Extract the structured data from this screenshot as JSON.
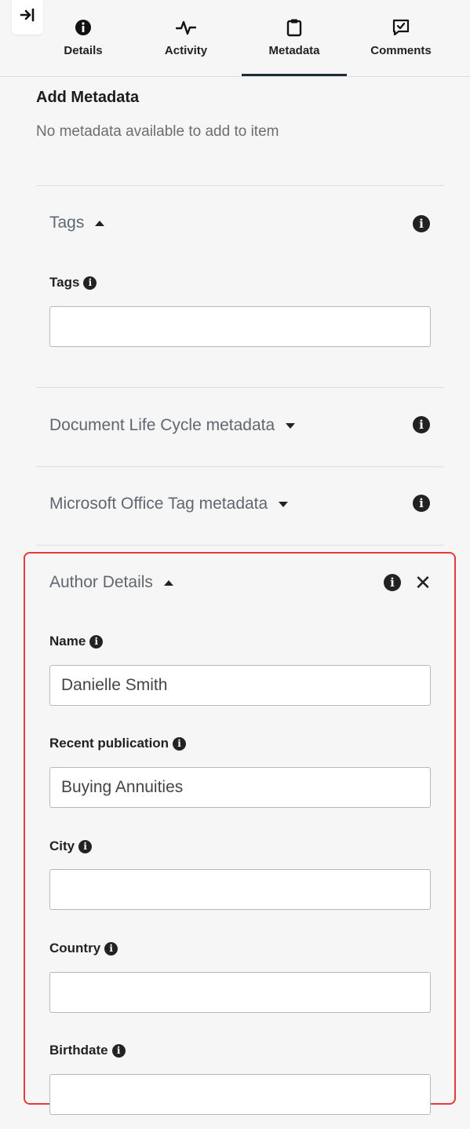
{
  "tabs": [
    {
      "label": "Details",
      "icon": "info-icon"
    },
    {
      "label": "Activity",
      "icon": "activity-icon"
    },
    {
      "label": "Metadata",
      "icon": "clipboard-icon",
      "active": true
    },
    {
      "label": "Comments",
      "icon": "comment-check-icon"
    }
  ],
  "add_metadata": {
    "title": "Add Metadata",
    "empty_text": "No metadata available to add to item"
  },
  "sections": {
    "tags": {
      "title": "Tags",
      "expanded": true,
      "fields": [
        {
          "label": "Tags",
          "value": ""
        }
      ]
    },
    "doc_life_cycle": {
      "title": "Document Life Cycle metadata",
      "expanded": false
    },
    "ms_office": {
      "title": "Microsoft Office Tag metadata",
      "expanded": false
    },
    "author": {
      "title": "Author Details",
      "expanded": true,
      "fields": [
        {
          "label": "Name",
          "value": "Danielle Smith"
        },
        {
          "label": "Recent publication",
          "value": "Buying Annuities"
        },
        {
          "label": "City",
          "value": ""
        },
        {
          "label": "Country",
          "value": ""
        },
        {
          "label": "Birthdate",
          "value": ""
        }
      ]
    }
  },
  "colors": {
    "highlight": "#e23b3b",
    "active_tab": "#1d2a3a"
  }
}
